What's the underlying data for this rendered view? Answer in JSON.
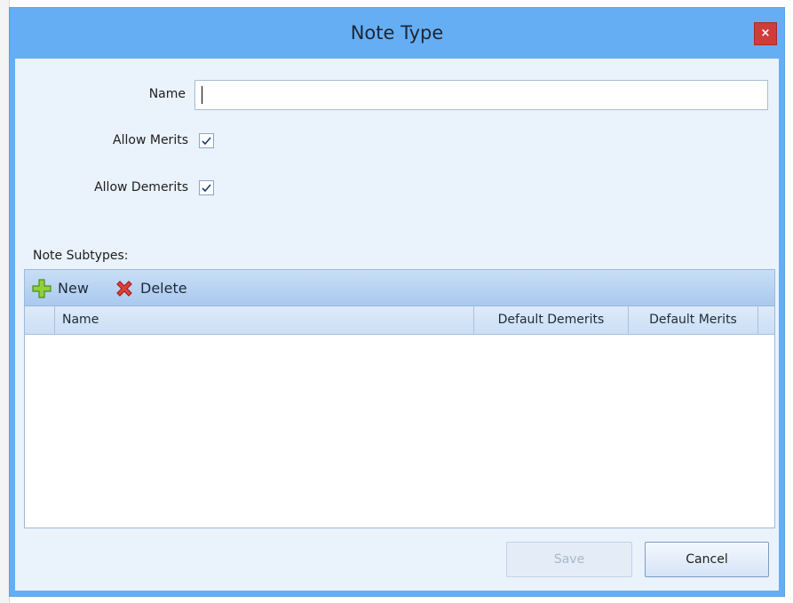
{
  "window": {
    "title": "Note Type",
    "close_glyph": "×"
  },
  "form": {
    "name_label": "Name",
    "name_value": "",
    "allow_merits_label": "Allow Merits",
    "allow_merits_checked": true,
    "allow_demerits_label": "Allow Demerits",
    "allow_demerits_checked": true,
    "subtypes_label": "Note Subtypes:"
  },
  "toolbar": {
    "new_label": "New",
    "new_icon": "plus-icon",
    "delete_label": "Delete",
    "delete_icon": "delete-x-icon"
  },
  "grid": {
    "columns": [
      "Name",
      "Default Demerits",
      "Default Merits"
    ],
    "rows": []
  },
  "buttons": {
    "save_label": "Save",
    "save_enabled": false,
    "cancel_label": "Cancel"
  },
  "colors": {
    "title_bar": "#66aef4",
    "client_bg": "#eaf2fc",
    "close_button": "#cd3d3d",
    "plus_icon": "#8ed13a",
    "delete_icon": "#e0403a"
  }
}
